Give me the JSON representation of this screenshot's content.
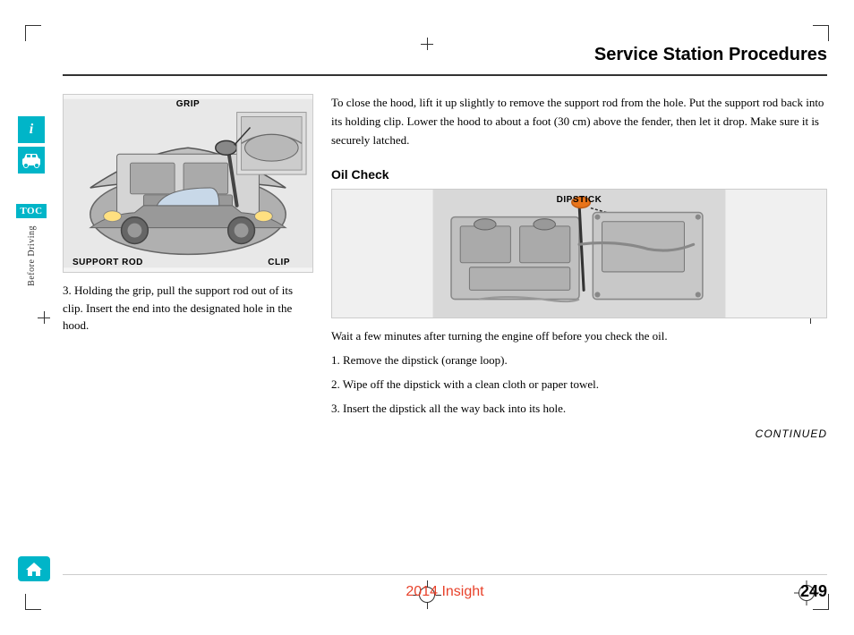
{
  "page": {
    "title": "Service Station Procedures",
    "footer": {
      "year_model": "2014 Insight",
      "page_number": "249"
    }
  },
  "sidebar": {
    "info_icon": "i",
    "toc_label": "TOC",
    "section_label": "Before Driving",
    "home_label": "Home"
  },
  "left_column": {
    "image_labels": {
      "grip": "GRIP",
      "support_rod": "SUPPORT ROD",
      "clip": "CLIP"
    },
    "step3": "3. Holding the grip, pull the support rod out of its clip. Insert the end into the designated hole in the hood."
  },
  "right_column": {
    "close_hood_text": "To close the hood, lift it up slightly to remove the support rod from the hole. Put the support rod back into its holding clip. Lower the hood to about a foot (30 cm) above the fender, then let it drop. Make sure it is securely latched.",
    "oil_check": {
      "title": "Oil Check",
      "dipstick_label": "DIPSTICK",
      "intro": "Wait a few minutes after turning the engine off before you check the oil.",
      "step1": "1. Remove the dipstick (orange loop).",
      "step2": "2. Wipe off the dipstick with a clean cloth or paper towel.",
      "step3": "3. Insert the dipstick all the way back into its hole.",
      "continued": "CONTINUED"
    }
  }
}
